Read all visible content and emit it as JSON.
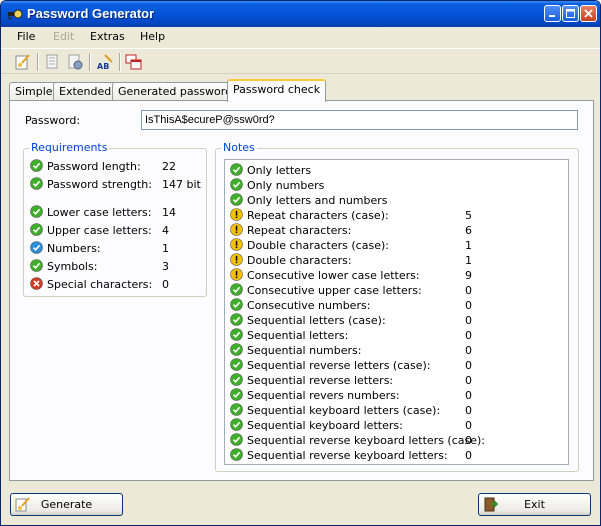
{
  "window": {
    "title": "Password Generator"
  },
  "menu": [
    "File",
    "Edit",
    "Extras",
    "Help"
  ],
  "tabs": [
    "Simple",
    "Extended",
    "Generated passwords",
    "Password check"
  ],
  "password": {
    "label": "Password:",
    "value": "IsThisA$ecureP@ssw0rd?"
  },
  "requirements": {
    "title": "Requirements",
    "items": [
      {
        "label": "Password length:",
        "value": "22",
        "status": "ok"
      },
      {
        "label": "Password strength:",
        "value": "147 bit",
        "status": "ok"
      },
      {
        "label": "Lower case letters:",
        "value": "14",
        "status": "ok"
      },
      {
        "label": "Upper case letters:",
        "value": "4",
        "status": "ok"
      },
      {
        "label": "Numbers:",
        "value": "1",
        "status": "info"
      },
      {
        "label": "Symbols:",
        "value": "3",
        "status": "ok"
      },
      {
        "label": "Special characters:",
        "value": "0",
        "status": "error"
      }
    ]
  },
  "notes": {
    "title": "Notes",
    "items": [
      {
        "label": "Only letters",
        "value": "",
        "status": "ok"
      },
      {
        "label": "Only numbers",
        "value": "",
        "status": "ok"
      },
      {
        "label": "Only letters and numbers",
        "value": "",
        "status": "ok"
      },
      {
        "label": "Repeat characters (case):",
        "value": "5",
        "status": "warn"
      },
      {
        "label": "Repeat characters:",
        "value": "6",
        "status": "warn"
      },
      {
        "label": "Double characters (case):",
        "value": "1",
        "status": "warn"
      },
      {
        "label": "Double characters:",
        "value": "1",
        "status": "warn"
      },
      {
        "label": "Consecutive lower case letters:",
        "value": "9",
        "status": "warn"
      },
      {
        "label": "Consecutive upper case letters:",
        "value": "0",
        "status": "ok"
      },
      {
        "label": "Consecutive numbers:",
        "value": "0",
        "status": "ok"
      },
      {
        "label": "Sequential letters (case):",
        "value": "0",
        "status": "ok"
      },
      {
        "label": "Sequential letters:",
        "value": "0",
        "status": "ok"
      },
      {
        "label": "Sequential numbers:",
        "value": "0",
        "status": "ok"
      },
      {
        "label": "Sequential reverse letters (case):",
        "value": "0",
        "status": "ok"
      },
      {
        "label": "Sequential reverse letters:",
        "value": "0",
        "status": "ok"
      },
      {
        "label": "Sequential revers numbers:",
        "value": "0",
        "status": "ok"
      },
      {
        "label": "Sequential keyboard letters (case):",
        "value": "0",
        "status": "ok"
      },
      {
        "label": "Sequential keyboard letters:",
        "value": "0",
        "status": "ok"
      },
      {
        "label": "Sequential reverse keyboard letters (case):",
        "value": "0",
        "status": "ok"
      },
      {
        "label": "Sequential reverse keyboard letters:",
        "value": "0",
        "status": "ok"
      }
    ]
  },
  "buttons": {
    "generate": "Generate",
    "exit": "Exit"
  },
  "colors": {
    "ok": "#3fae2a",
    "warn": "#f2c200",
    "info": "#2a8fd6",
    "error": "#d23a2a",
    "group_title": "#0046d5"
  }
}
